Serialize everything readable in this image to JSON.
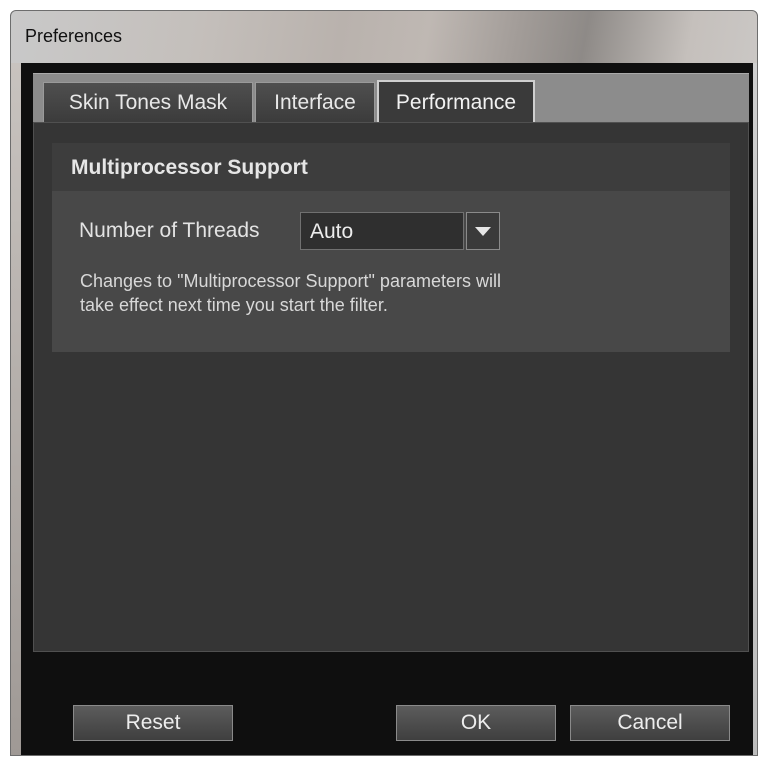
{
  "window": {
    "title": "Preferences"
  },
  "tabs": [
    {
      "label": "Skin Tones Mask"
    },
    {
      "label": "Interface"
    },
    {
      "label": "Performance",
      "active": true
    }
  ],
  "section": {
    "title": "Multiprocessor Support",
    "threads": {
      "label": "Number of Threads",
      "value": "Auto"
    },
    "note_line1": "Changes to \"Multiprocessor Support\" parameters will",
    "note_line2": "take effect next time you start the filter."
  },
  "buttons": {
    "reset": "Reset",
    "ok": "OK",
    "cancel": "Cancel"
  },
  "colors": {
    "panel": "#353535",
    "section": "#484848",
    "background": "#0f0f0f",
    "tabstrip": "#8c8c8c"
  },
  "icons": {
    "dropdown": "chevron-down-icon"
  }
}
